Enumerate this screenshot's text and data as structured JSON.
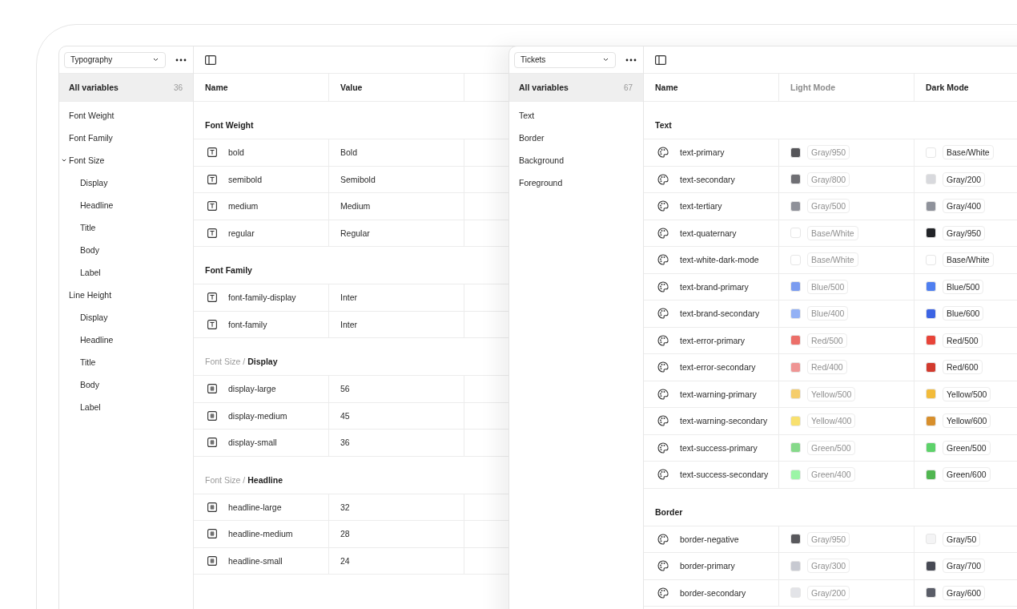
{
  "windows": [
    {
      "collection": "Typography",
      "sidebar": {
        "all": {
          "label": "All variables",
          "count": "36",
          "selected": true
        },
        "items": [
          {
            "label": "Font Weight",
            "selected": false,
            "chevron": false
          },
          {
            "label": "Font Family",
            "selected": false,
            "chevron": false
          },
          {
            "label": "Font Size",
            "selected": false,
            "chevron": true,
            "children": [
              {
                "label": "Display",
                "selected": false
              },
              {
                "label": "Headline",
                "selected": false
              },
              {
                "label": "Title",
                "selected": false
              },
              {
                "label": "Body",
                "selected": false
              },
              {
                "label": "Label",
                "selected": false
              }
            ]
          },
          {
            "label": "Line Height",
            "selected": false,
            "chevron": false,
            "children": [
              {
                "label": "Display",
                "selected": false
              },
              {
                "label": "Headline",
                "selected": false
              },
              {
                "label": "Title",
                "selected": false
              },
              {
                "label": "Body",
                "selected": false
              },
              {
                "label": "Label",
                "selected": false
              }
            ]
          }
        ]
      },
      "columns": [
        {
          "label": "Name",
          "muted": false
        },
        {
          "label": "Value",
          "muted": false
        }
      ],
      "groups": [
        {
          "title": "Font Weight",
          "rows": [
            {
              "kind": "string",
              "name": "bold",
              "cells": [
                {
                  "value": "Bold"
                }
              ]
            },
            {
              "kind": "string",
              "name": "semibold",
              "cells": [
                {
                  "value": "Semibold"
                }
              ]
            },
            {
              "kind": "string",
              "name": "medium",
              "cells": [
                {
                  "value": "Medium"
                }
              ]
            },
            {
              "kind": "string",
              "name": "regular",
              "cells": [
                {
                  "value": "Regular"
                }
              ]
            }
          ]
        },
        {
          "title": "Font Family",
          "rows": [
            {
              "kind": "string",
              "name": "font-family-display",
              "cells": [
                {
                  "value": "Inter"
                }
              ]
            },
            {
              "kind": "string",
              "name": "font-family",
              "cells": [
                {
                  "value": "Inter"
                }
              ]
            }
          ]
        },
        {
          "prefix": "Font Size /",
          "title": "Display",
          "rows": [
            {
              "kind": "number",
              "name": "display-large",
              "cells": [
                {
                  "value": "56"
                }
              ]
            },
            {
              "kind": "number",
              "name": "display-medium",
              "cells": [
                {
                  "value": "45"
                }
              ]
            },
            {
              "kind": "number",
              "name": "display-small",
              "cells": [
                {
                  "value": "36"
                }
              ]
            }
          ]
        },
        {
          "prefix": "Font Size /",
          "title": "Headline",
          "rows": [
            {
              "kind": "number",
              "name": "headline-large",
              "cells": [
                {
                  "value": "32"
                }
              ]
            },
            {
              "kind": "number",
              "name": "headline-medium",
              "cells": [
                {
                  "value": "28"
                }
              ]
            },
            {
              "kind": "number",
              "name": "headline-small",
              "cells": [
                {
                  "value": "24"
                }
              ]
            }
          ]
        }
      ]
    },
    {
      "collection": "Tickets",
      "sidebar": {
        "all": {
          "label": "All variables",
          "count": "67",
          "selected": true
        },
        "items": [
          {
            "label": "Text",
            "selected": false,
            "chevron": false
          },
          {
            "label": "Border",
            "selected": false,
            "chevron": false
          },
          {
            "label": "Background",
            "selected": false,
            "chevron": false
          },
          {
            "label": "Foreground",
            "selected": false,
            "chevron": false
          }
        ]
      },
      "columns": [
        {
          "label": "Name",
          "muted": false
        },
        {
          "label": "Light Mode",
          "muted": true
        },
        {
          "label": "Dark Mode",
          "muted": false
        }
      ],
      "groups": [
        {
          "title": "Text",
          "rows": [
            {
              "kind": "color",
              "name": "text-primary",
              "cells": [
                {
                  "value": "Gray/950",
                  "color": "#56565a"
                },
                {
                  "value": "Base/White",
                  "color": "#ffffff"
                }
              ]
            },
            {
              "kind": "color",
              "name": "text-secondary",
              "cells": [
                {
                  "value": "Gray/800",
                  "color": "#6f6f74"
                },
                {
                  "value": "Gray/200",
                  "color": "#d8d9dd"
                }
              ]
            },
            {
              "kind": "color",
              "name": "text-tertiary",
              "cells": [
                {
                  "value": "Gray/500",
                  "color": "#8f9199"
                },
                {
                  "value": "Gray/400",
                  "color": "#8f929b"
                }
              ]
            },
            {
              "kind": "color",
              "name": "text-quaternary",
              "cells": [
                {
                  "value": "Base/White",
                  "color": "#ffffff"
                },
                {
                  "value": "Gray/950",
                  "color": "#222428"
                }
              ]
            },
            {
              "kind": "color",
              "name": "text-white-dark-mode",
              "cells": [
                {
                  "value": "Base/White",
                  "color": "#ffffff"
                },
                {
                  "value": "Base/White",
                  "color": "#ffffff"
                }
              ]
            },
            {
              "kind": "color",
              "name": "text-brand-primary",
              "cells": [
                {
                  "value": "Blue/500",
                  "color": "#7b9cf0"
                },
                {
                  "value": "Blue/500",
                  "color": "#4f7ff0"
                }
              ]
            },
            {
              "kind": "color",
              "name": "text-brand-secondary",
              "cells": [
                {
                  "value": "Blue/400",
                  "color": "#93b1f5"
                },
                {
                  "value": "Blue/600",
                  "color": "#3c64e4"
                }
              ]
            },
            {
              "kind": "color",
              "name": "text-error-primary",
              "cells": [
                {
                  "value": "Red/500",
                  "color": "#ec6f69"
                },
                {
                  "value": "Red/500",
                  "color": "#e84439"
                }
              ]
            },
            {
              "kind": "color",
              "name": "text-error-secondary",
              "cells": [
                {
                  "value": "Red/400",
                  "color": "#ef9594"
                },
                {
                  "value": "Red/600",
                  "color": "#d23a2e"
                }
              ]
            },
            {
              "kind": "color",
              "name": "text-warning-primary",
              "cells": [
                {
                  "value": "Yellow/500",
                  "color": "#f5cd6b"
                },
                {
                  "value": "Yellow/500",
                  "color": "#f2bb3a"
                }
              ]
            },
            {
              "kind": "color",
              "name": "text-warning-secondary",
              "cells": [
                {
                  "value": "Yellow/400",
                  "color": "#f8e06e"
                },
                {
                  "value": "Yellow/600",
                  "color": "#d88f2c"
                }
              ]
            },
            {
              "kind": "color",
              "name": "text-success-primary",
              "cells": [
                {
                  "value": "Green/500",
                  "color": "#86d98a"
                },
                {
                  "value": "Green/500",
                  "color": "#5dd26a"
                }
              ]
            },
            {
              "kind": "color",
              "name": "text-success-secondary",
              "cells": [
                {
                  "value": "Green/400",
                  "color": "#9cf5a6"
                },
                {
                  "value": "Green/600",
                  "color": "#50b650"
                }
              ]
            }
          ]
        },
        {
          "title": "Border",
          "rows": [
            {
              "kind": "color",
              "name": "border-negative",
              "cells": [
                {
                  "value": "Gray/950",
                  "color": "#58585c"
                },
                {
                  "value": "Gray/50",
                  "color": "#f4f4f5"
                }
              ]
            },
            {
              "kind": "color",
              "name": "border-primary",
              "cells": [
                {
                  "value": "Gray/300",
                  "color": "#c7c9d1"
                },
                {
                  "value": "Gray/700",
                  "color": "#474a54"
                }
              ]
            },
            {
              "kind": "color",
              "name": "border-secondary",
              "cells": [
                {
                  "value": "Gray/200",
                  "color": "#e3e4e8"
                },
                {
                  "value": "Gray/600",
                  "color": "#5a5d68"
                }
              ]
            }
          ]
        }
      ]
    }
  ]
}
